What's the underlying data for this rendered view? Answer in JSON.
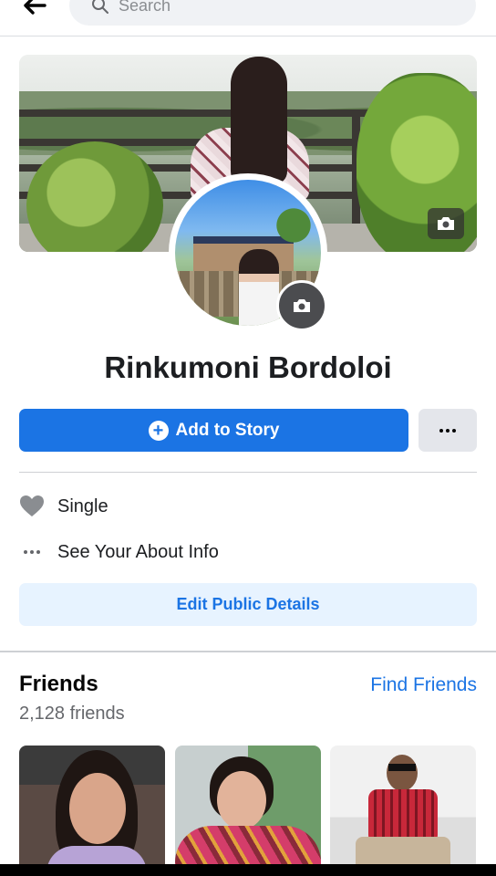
{
  "search": {
    "placeholder": "Search"
  },
  "profile": {
    "name": "Rinkumoni Bordoloi"
  },
  "actions": {
    "add_story_label": "Add to Story"
  },
  "intro": {
    "relationship": "Single",
    "about_link": "See Your About Info",
    "edit_public_label": "Edit Public Details"
  },
  "friends": {
    "title": "Friends",
    "find_link": "Find Friends",
    "count_text": "2,128 friends"
  },
  "colors": {
    "accent": "#1b74e4",
    "secondary_button": "#e4e6eb",
    "soft_blue": "#e7f3ff",
    "muted_text": "#65676b"
  },
  "icons": {
    "back": "arrow-left-icon",
    "search": "search-icon",
    "cover_camera": "camera-icon",
    "avatar_camera": "camera-icon",
    "add_story": "plus-circle-icon",
    "more": "ellipsis-icon",
    "relationship": "heart-icon",
    "about": "ellipsis-icon"
  }
}
